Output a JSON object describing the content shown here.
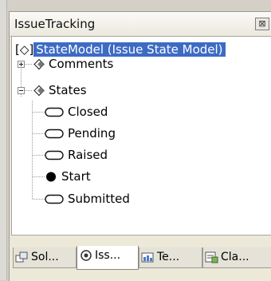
{
  "panel": {
    "title": "IssueTracking",
    "close_glyph": "⊠"
  },
  "tree": {
    "root": {
      "prefix": "[◇]",
      "label": "StateModel (Issue State Model)"
    },
    "nodes": [
      {
        "label": "Comments",
        "expander": "+",
        "icon": "diamond-icon"
      },
      {
        "label": "States",
        "expander": "−",
        "icon": "diamond-icon"
      }
    ],
    "states": [
      {
        "label": "Closed",
        "icon": "state-ellipse-icon"
      },
      {
        "label": "Pending",
        "icon": "state-ellipse-icon"
      },
      {
        "label": "Raised",
        "icon": "state-ellipse-icon"
      },
      {
        "label": "Start",
        "icon": "start-dot-icon"
      },
      {
        "label": "Submitted",
        "icon": "state-ellipse-icon"
      }
    ]
  },
  "tabs": [
    {
      "label": "Sol...",
      "icon": "solution-explorer-icon",
      "active": false
    },
    {
      "label": "Iss...",
      "icon": "issue-model-icon",
      "active": true
    },
    {
      "label": "Te...",
      "icon": "team-explorer-icon",
      "active": false
    },
    {
      "label": "Cla...",
      "icon": "class-view-icon",
      "active": false
    }
  ],
  "colors": {
    "selection": "#3d6bc4",
    "panel_bg": "#ece9d8"
  }
}
